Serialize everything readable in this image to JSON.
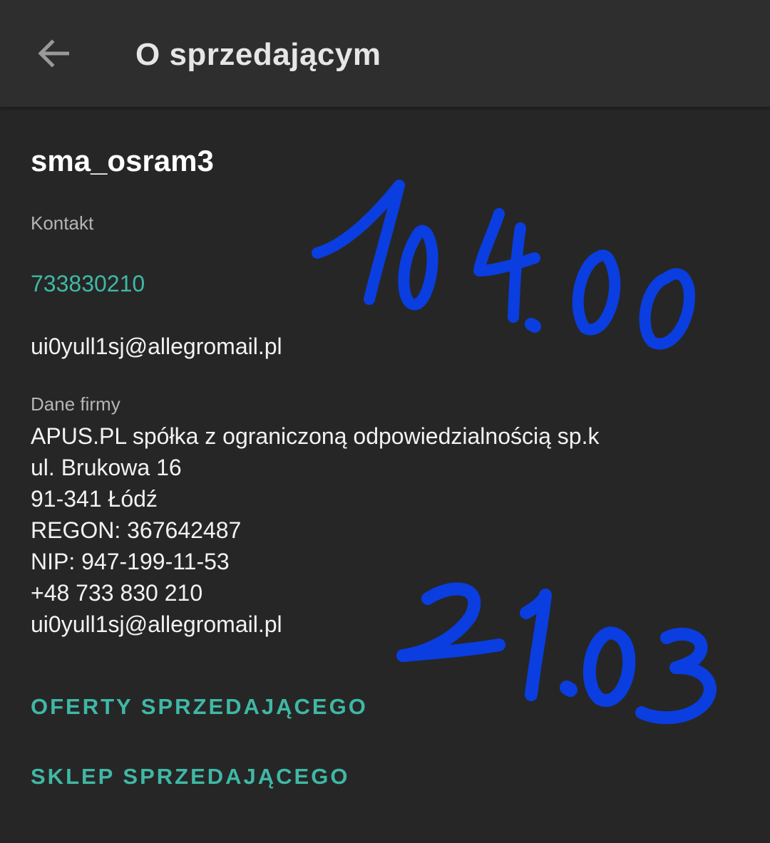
{
  "header": {
    "back_icon": "arrow-left-icon",
    "title": "O sprzedającym"
  },
  "seller": {
    "name": "sma_osram3",
    "contact_label": "Kontakt",
    "phone": "733830210",
    "email": "ui0yull1sj@allegromail.pl",
    "company_label": "Dane firmy",
    "company_lines": [
      "APUS.PL spółka z ograniczoną odpowiedzialnością sp.k",
      "ul. Brukowa 16",
      "91-341 Łódź",
      "REGON: 367642487",
      "NIP: 947-199-11-53",
      "+48 733 830 210",
      "ui0yull1sj@allegromail.pl"
    ]
  },
  "actions": {
    "offers_label": "OFERTY SPRZEDAJĄCEGO",
    "shop_label": "SKLEP SPRZEDAJĄCEGO"
  },
  "annotations": {
    "top_note": "104.00",
    "bottom_note": "21.03",
    "ink_color": "#0a3ee0"
  },
  "colors": {
    "background": "#262626",
    "appbar": "#2e2e2e",
    "accent": "#3fb8a5"
  }
}
